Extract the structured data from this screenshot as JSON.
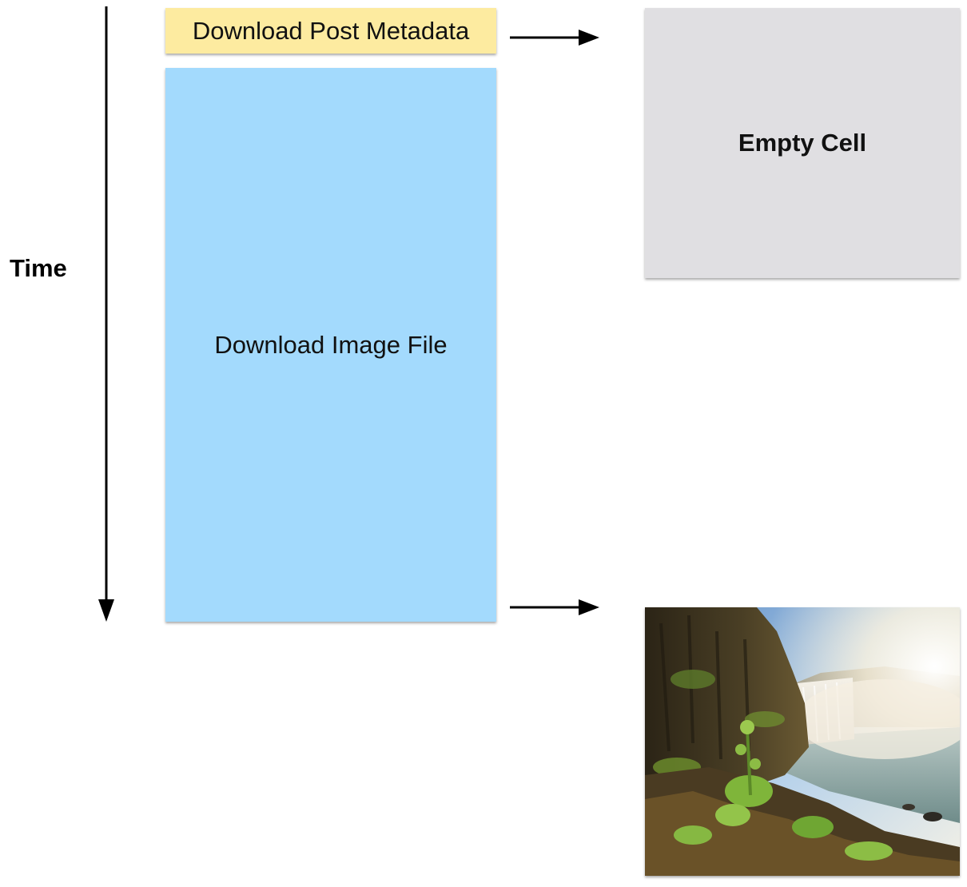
{
  "axis": {
    "label": "Time"
  },
  "steps": {
    "metadata_label": "Download Post Metadata",
    "image_label": "Download Image File"
  },
  "results": {
    "empty_cell_label": "Empty Cell",
    "photo_subject": "waterfall-photo"
  },
  "colors": {
    "metadata_box": "#fdeba0",
    "image_box": "#a3dafd",
    "empty_cell": "#e0dfe2",
    "arrows": "#000000"
  }
}
